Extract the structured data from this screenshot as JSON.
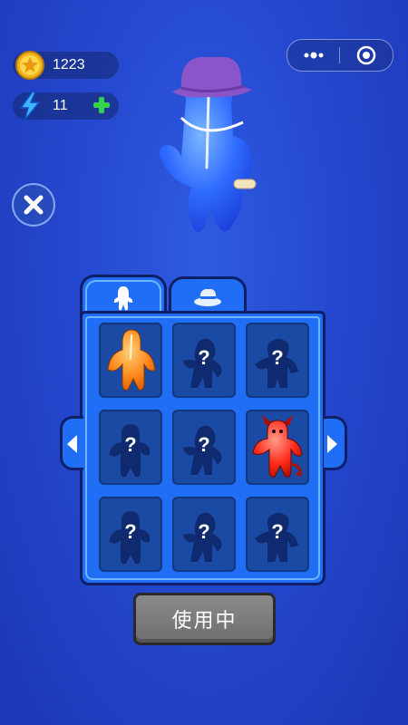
{
  "hud": {
    "coins": {
      "icon": "star-coin-icon",
      "value": "1223"
    },
    "energy": {
      "icon": "lightning-icon",
      "value": "11",
      "add_icon": "plus-icon"
    }
  },
  "window_controls": {
    "more_icon": "more-dots-icon",
    "close_icon": "target-circle-icon"
  },
  "close_icon": "close-x-icon",
  "tabs": [
    {
      "name": "characters",
      "icon": "character-icon",
      "active": true
    },
    {
      "name": "hats",
      "icon": "hat-icon",
      "active": false
    }
  ],
  "grid": {
    "cells": [
      {
        "state": "unlocked",
        "color": "#ff8a1c",
        "figure": "blob"
      },
      {
        "state": "locked",
        "label": "?"
      },
      {
        "state": "locked",
        "label": "?"
      },
      {
        "state": "locked",
        "label": "?"
      },
      {
        "state": "locked",
        "label": "?"
      },
      {
        "state": "unlocked",
        "color": "#ff2a1a",
        "figure": "devil"
      },
      {
        "state": "locked",
        "label": "?"
      },
      {
        "state": "locked",
        "label": "?"
      },
      {
        "state": "locked",
        "label": "?"
      }
    ]
  },
  "nav": {
    "prev_icon": "arrow-left-icon",
    "next_icon": "arrow-right-icon"
  },
  "use_button": {
    "label": "使用中"
  },
  "colors": {
    "background": "#2448cf",
    "panel": "#1f6ef5",
    "outline": "#0e1f66",
    "character": "#2e66ff",
    "hat": "#8a55c8"
  }
}
